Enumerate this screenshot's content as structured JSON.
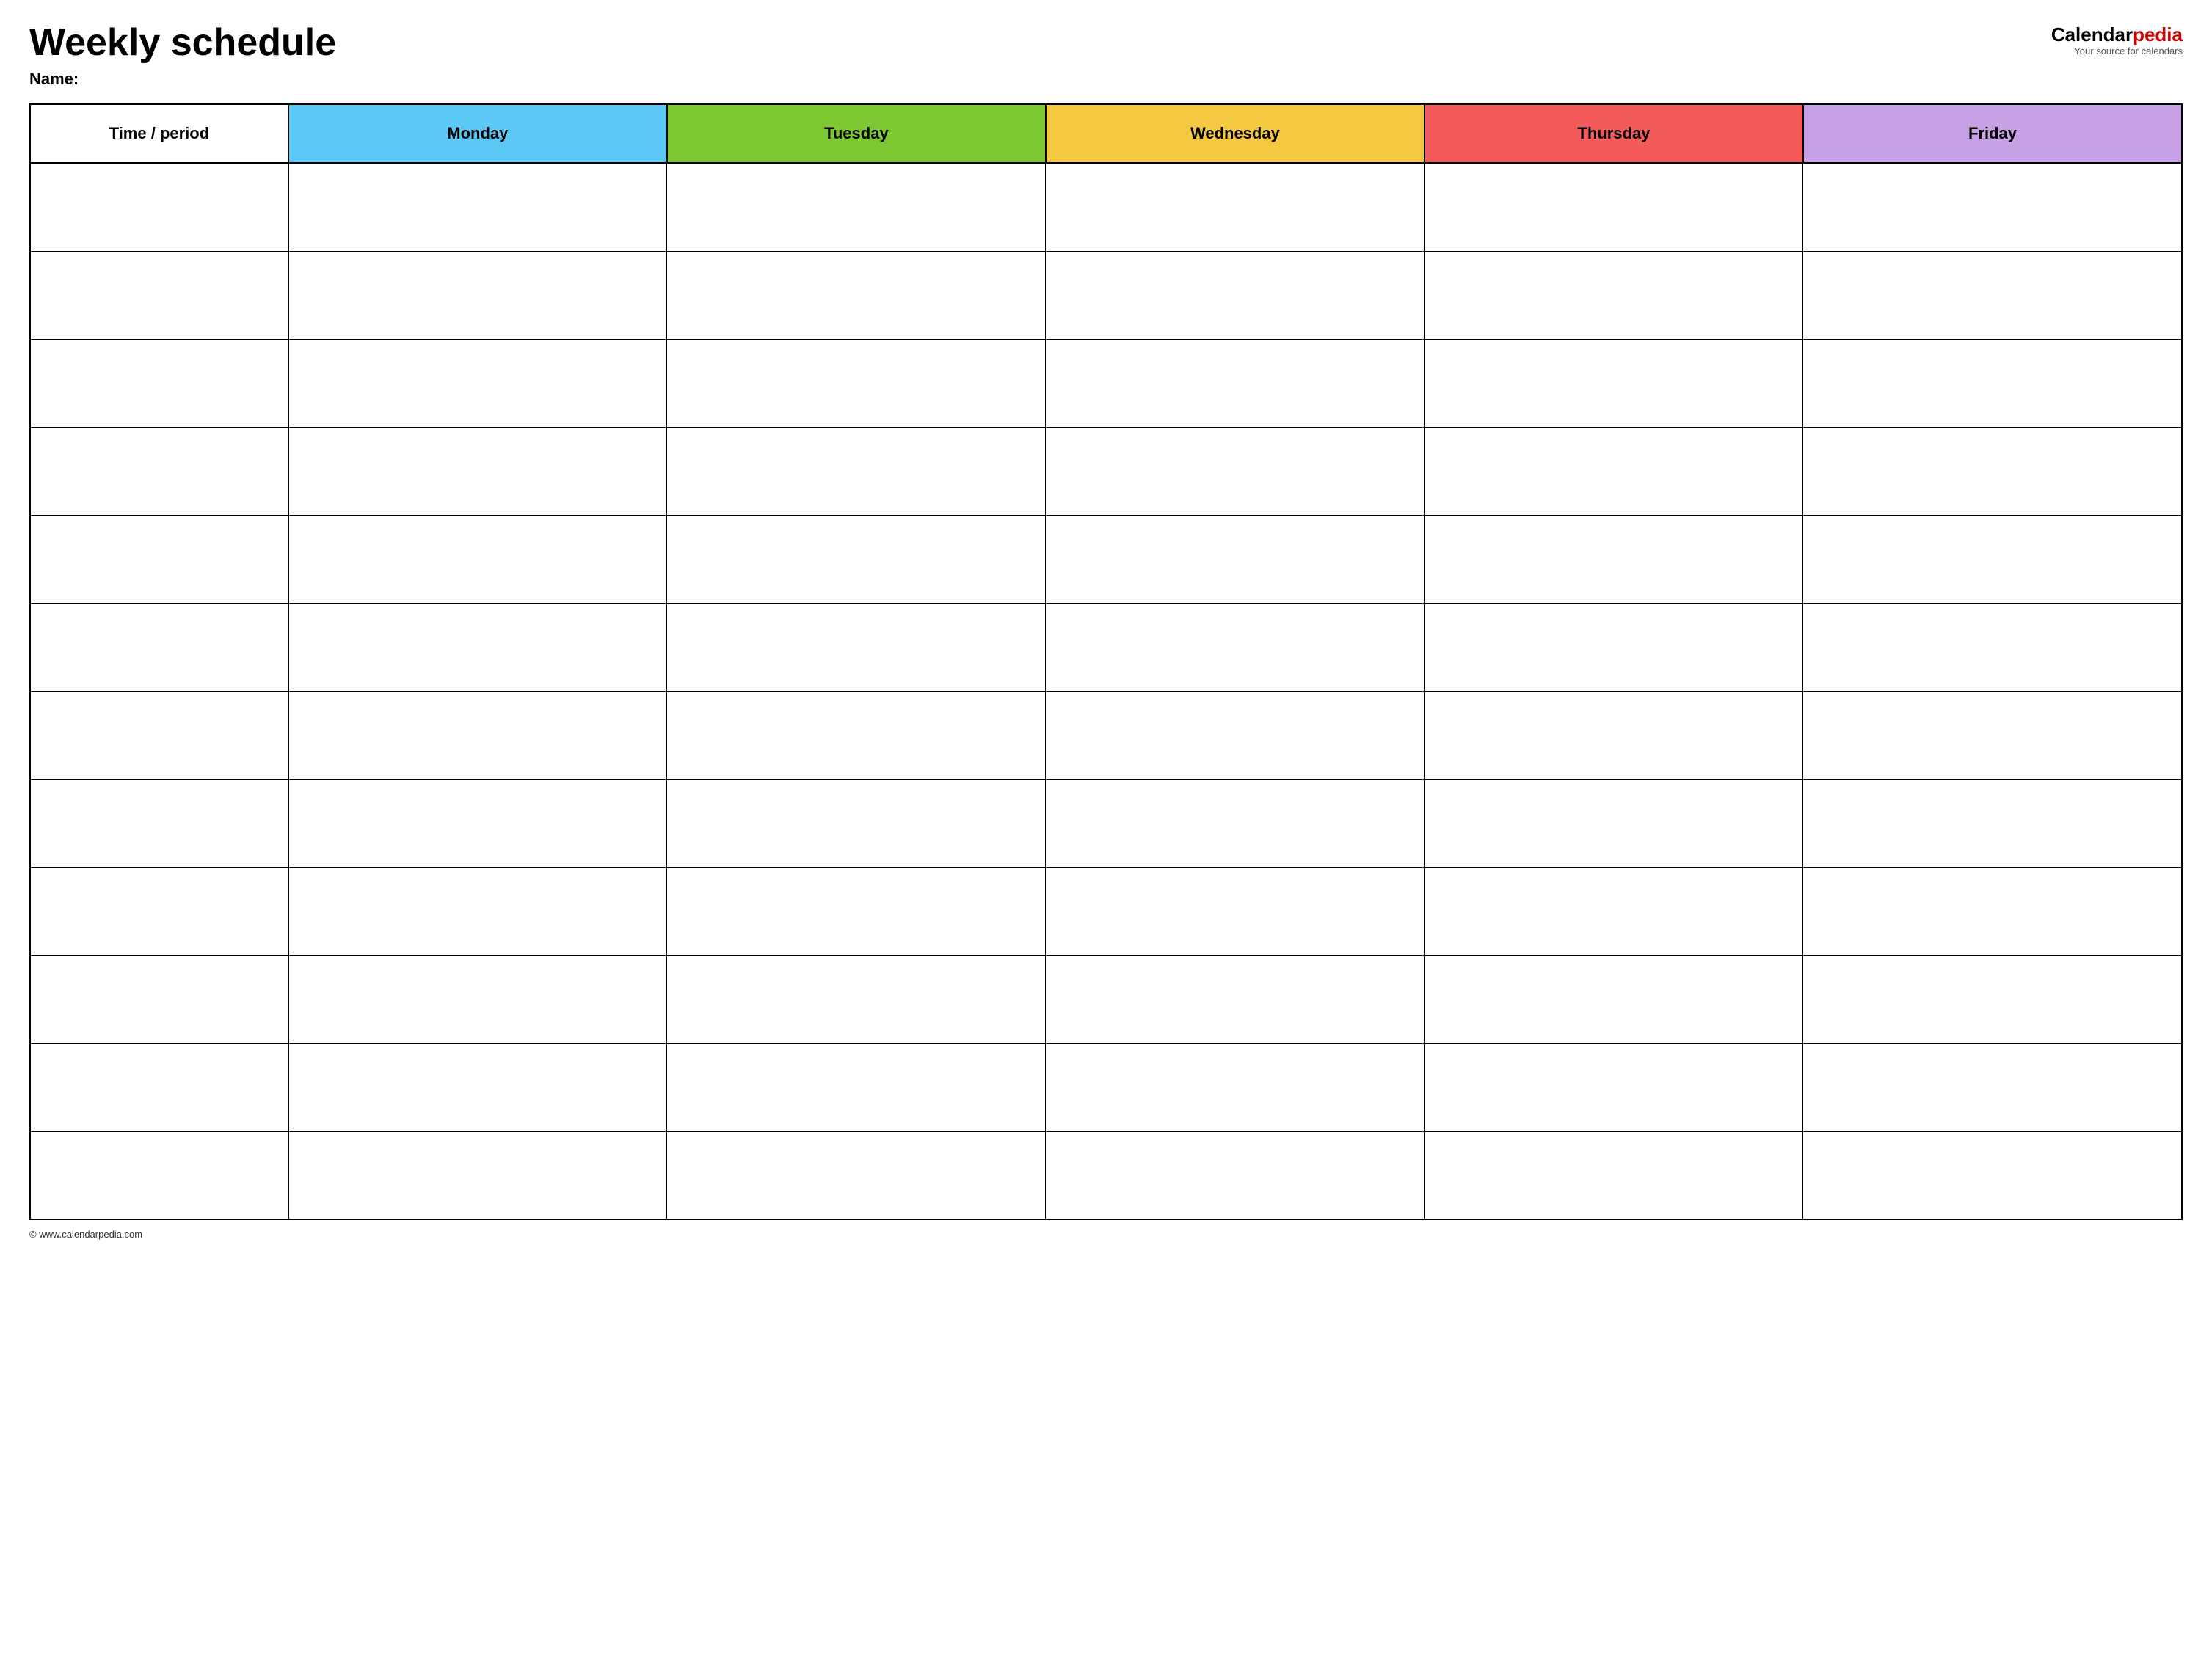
{
  "header": {
    "title": "Weekly schedule",
    "name_label": "Name:",
    "logo": {
      "calendar_part": "Calendar",
      "pedia_part": "pedia",
      "subtitle": "Your source for calendars"
    }
  },
  "table": {
    "columns": [
      {
        "id": "time",
        "label": "Time / period",
        "color": "#ffffff"
      },
      {
        "id": "monday",
        "label": "Monday",
        "color": "#5bc8f5"
      },
      {
        "id": "tuesday",
        "label": "Tuesday",
        "color": "#7dc832"
      },
      {
        "id": "wednesday",
        "label": "Wednesday",
        "color": "#f5c842"
      },
      {
        "id": "thursday",
        "label": "Thursday",
        "color": "#f55a5a"
      },
      {
        "id": "friday",
        "label": "Friday",
        "color": "#c8a0e6"
      }
    ],
    "row_count": 12
  },
  "footer": {
    "copyright": "© www.calendarpedia.com"
  }
}
